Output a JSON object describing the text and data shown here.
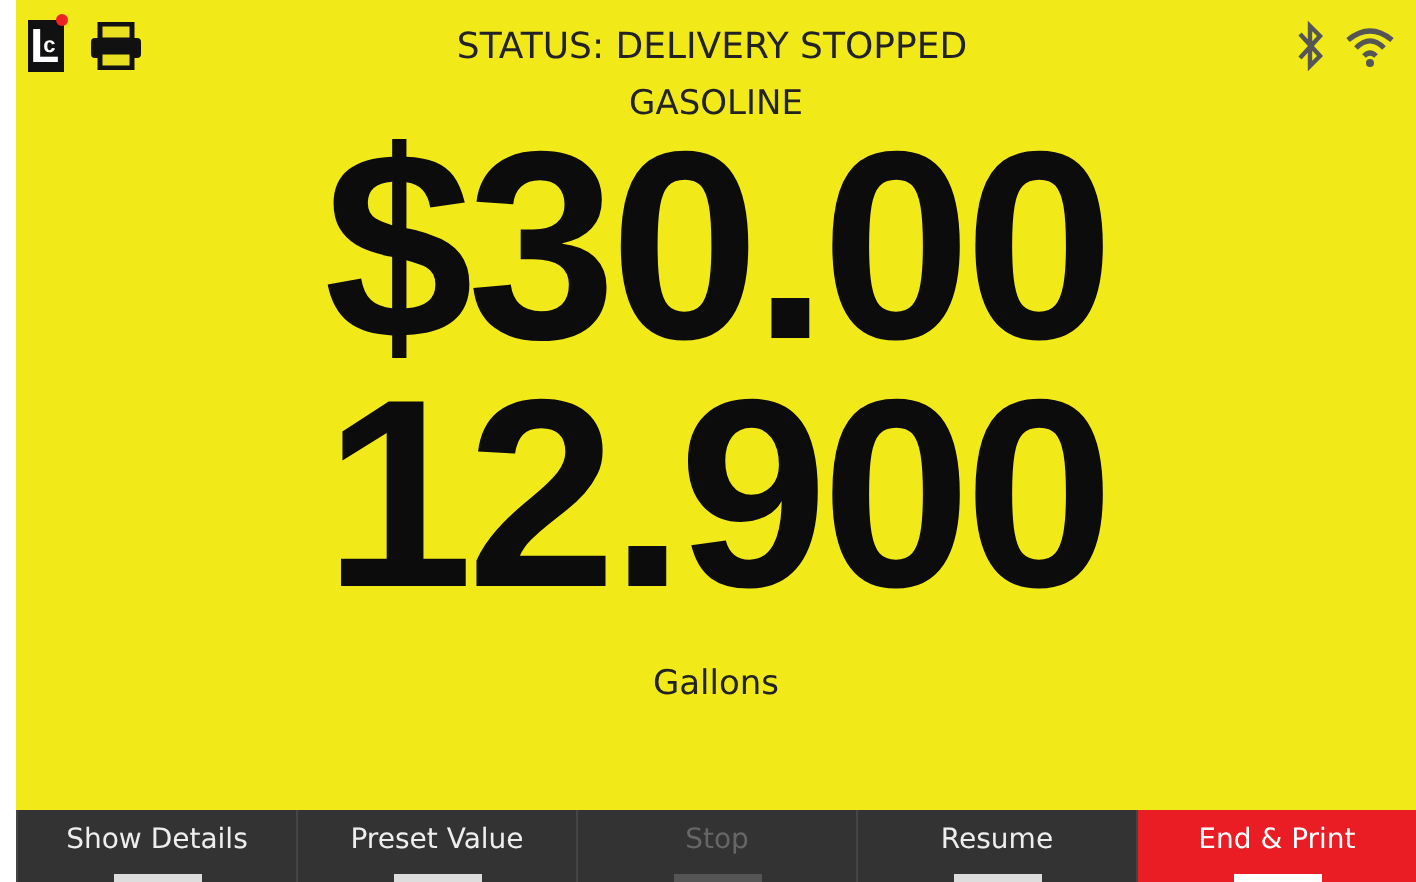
{
  "header": {
    "logo_letters": [
      "L",
      "c"
    ],
    "status": "STATUS: DELIVERY STOPPED"
  },
  "product": "GASOLINE",
  "amount": "$30.00",
  "volume": "12.900",
  "unit": "Gallons",
  "buttons": [
    {
      "label": "Show Details",
      "disabled": false,
      "accent": false
    },
    {
      "label": "Preset Value",
      "disabled": false,
      "accent": false
    },
    {
      "label": "Stop",
      "disabled": true,
      "accent": false
    },
    {
      "label": "Resume",
      "disabled": false,
      "accent": false
    },
    {
      "label": "End & Print",
      "disabled": false,
      "accent": true
    }
  ]
}
